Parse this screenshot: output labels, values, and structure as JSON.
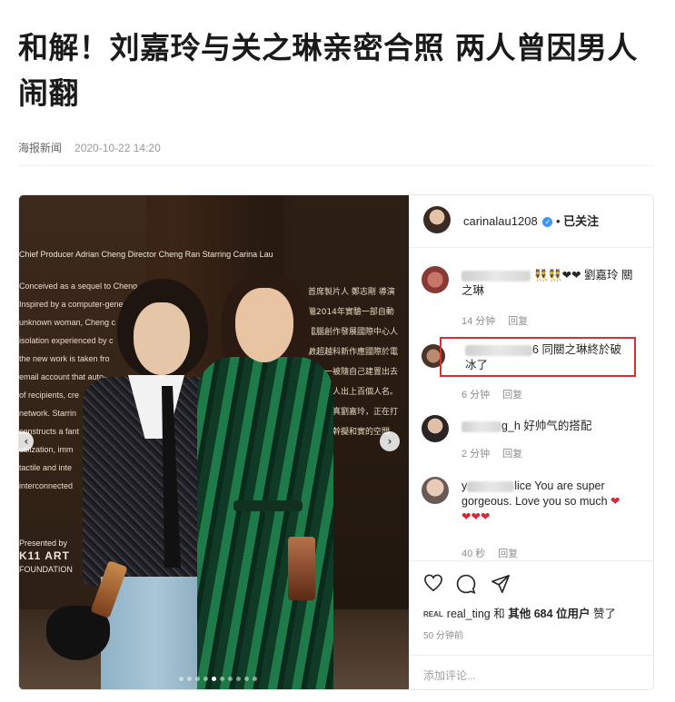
{
  "article": {
    "title": "和解！刘嘉玲与关之琳亲密合照 两人曾因男人闹翻",
    "source": "海报新闻",
    "date": "2020-10-22 14:20"
  },
  "photo": {
    "wall_credits": "Chief Producer Adrian Cheng  Director Cheng Ran  Starring Carina Lau",
    "wall_text": "Conceived as a sequel to Cheng\nInspired by a computer-gene\nunknown woman, Cheng c\nisolation experienced by c\nthe new work is taken fro\nemail account that auto-\nof recipients, cre\nnetwork. Starrin\nconstructs a fant\nutilization, imm\ntactile and inte\ninterconnected",
    "wall_cn_header": "首席製片人 鄭志剛  導演",
    "wall_cn_text": "繼2014年實驗一部自動電腦創作發展國際中心人數超越科新作應國際於電郵之一被隨自己建置出去了陌生人出上百個人名。電台鏡真劉嘉玲，正在打造一個幹擬和實的空間",
    "presented_by": "Presented by",
    "k11": "K11 ART",
    "foundation": "FOUNDATION",
    "prev_arrow": "‹",
    "next_arrow": "›",
    "slide_count": 10,
    "active_slide": 4
  },
  "instagram": {
    "username": "carinalau1208",
    "verified_mark": "✓",
    "separator": "•",
    "follow_status": "已关注",
    "comments": [
      {
        "emoji": "👯👯❤❤",
        "text": "劉嘉玲 關之琳",
        "time": "14 分钟",
        "reply": "回复"
      },
      {
        "suffix": "6",
        "text": "同關之琳終於破冰了",
        "time": "6 分钟",
        "reply": "回复"
      },
      {
        "suffix": "g_h",
        "text": "好帅气的搭配",
        "time": "2 分钟",
        "reply": "回复"
      },
      {
        "prefix": "y",
        "suffix": "lice",
        "text": "You are super gorgeous. Love you so much",
        "hearts": "❤",
        "hearts_line": "❤❤❤",
        "time": "40 秒",
        "reply": "回复"
      }
    ],
    "likes": {
      "badge": "REAL",
      "user": "real_ting",
      "and": "和",
      "others": "其他 684 位用户",
      "suffix": "赞了"
    },
    "time_ago": "50 分钟前",
    "add_comment_placeholder": "添加评论..."
  }
}
